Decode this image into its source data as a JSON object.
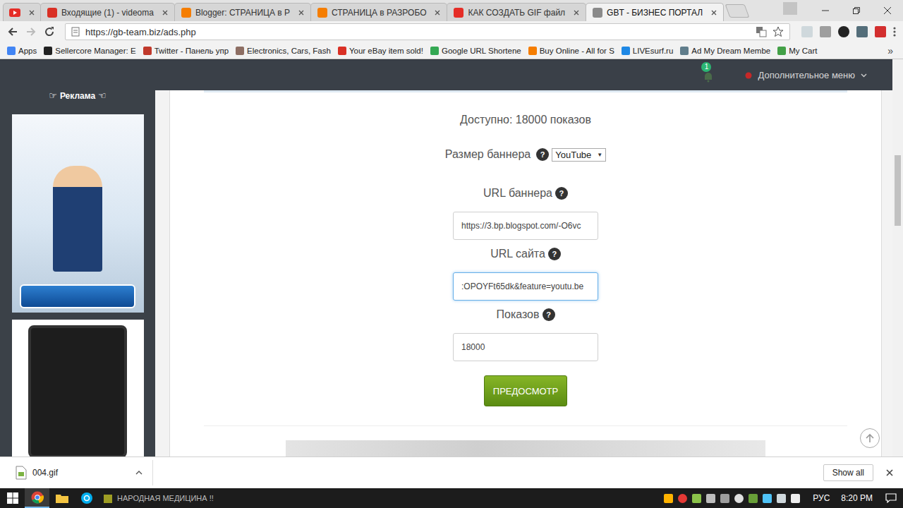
{
  "tabs": [
    {
      "label": "Входящие (1) - videoma",
      "selected": false,
      "color": "#d93025"
    },
    {
      "label": "Blogger: СТРАНИЦА в Р",
      "selected": false,
      "color": "#f57d00"
    },
    {
      "label": "СТРАНИЦА в РАЗРОБО",
      "selected": false,
      "color": "#f57d00"
    },
    {
      "label": "КАК СОЗДАТЬ GIF файл",
      "selected": false,
      "color": "#e52d27"
    },
    {
      "label": "GBT - БИЗНЕС ПОРТАЛ",
      "selected": true,
      "color": "#8a8a8a"
    }
  ],
  "address": "https://gb-team.biz/ads.php",
  "bookmarks": [
    {
      "label": "Apps",
      "color": "#4285f4"
    },
    {
      "label": "Sellercore Manager: E",
      "color": "#222222"
    },
    {
      "label": "Twitter - Панель упр",
      "color": "#c0392b"
    },
    {
      "label": "Electronics, Cars, Fash",
      "color": "#8d6e63"
    },
    {
      "label": "Your eBay item sold!",
      "color": "#d93025"
    },
    {
      "label": "Google URL Shortene",
      "color": "#34a853"
    },
    {
      "label": "Buy Online - All for S",
      "color": "#f57d00"
    },
    {
      "label": "LIVEsurf.ru",
      "color": "#1e88e5"
    },
    {
      "label": "Ad My Dream Membe",
      "color": "#607d8b"
    },
    {
      "label": "My Cart",
      "color": "#43a047"
    }
  ],
  "bookmarks_more": "»",
  "navbar": {
    "notification_count": "1",
    "menu": "Дополнительное меню"
  },
  "sidebar": {
    "title": "Реклама",
    "icon_left": "☞",
    "icon_right": "☜"
  },
  "form": {
    "available": "Доступно: 18000 показов",
    "help_glyph": "?",
    "caret": "▼",
    "fields": [
      {
        "label": "Размер баннера",
        "kind": "select",
        "value": "YouTube",
        "focused": false
      },
      {
        "label": "URL баннера",
        "kind": "input",
        "value": "https://3.bp.blogspot.com/-O6vc",
        "focused": false
      },
      {
        "label": "URL сайта",
        "kind": "input",
        "value": ":OPOYFt65dk&feature=youtu.be",
        "focused": true
      },
      {
        "label": "Показов",
        "kind": "input",
        "value": "18000",
        "focused": false
      }
    ],
    "submit": "ПРЕДОСМОТР"
  },
  "downloads": {
    "file": "004.gif",
    "show_all": "Show all"
  },
  "taskbar": {
    "app_label": "НАРОДНАЯ МЕДИЦИНА !!",
    "language": "РУС",
    "time": "8:20 PM"
  }
}
